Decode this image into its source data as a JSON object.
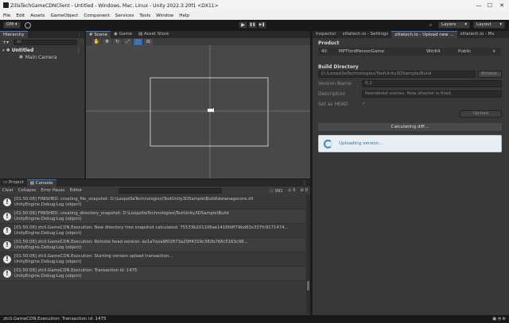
{
  "window": {
    "title": "ZillaTechGameCDNClient - Untitled - Windows, Mac, Linux - Unity 2022.3.20f1 <DX11>",
    "controls": [
      "—",
      "☐",
      "✕"
    ]
  },
  "menu": [
    "File",
    "Edit",
    "Assets",
    "GameObject",
    "Component",
    "Services",
    "Tools",
    "Window",
    "Help"
  ],
  "toolbar": {
    "account": "OM",
    "layers": "Layers",
    "layout": "Layout",
    "play": "▶",
    "pause": "❚❚",
    "step": "▶❚"
  },
  "hierarchy": {
    "tab": "Hierarchy",
    "scene": "Untitled",
    "items": [
      "Main Camera"
    ],
    "search_hint": "All"
  },
  "scene_tabs": [
    "Scene",
    "Game",
    "Asset Store"
  ],
  "console": {
    "tabs": [
      "Project",
      "Console"
    ],
    "toolbar": {
      "clear": "Clear",
      "collapse": "Collapse",
      "error_pause": "Error Pause",
      "editor": "Editor"
    },
    "counts": {
      "info": "991",
      "warn": "0",
      "error": "0"
    },
    "logs": [
      {
        "line1": "[01:50:08] FINISHED: creating_file_snapshot: D:\\LoopzillaTechnologies\\TestUnity3DSample\\Build\\datanagecore.dll",
        "line2": "UnityEngine.Debug:Log (object)"
      },
      {
        "line1": "[01:50:08] FINISHED: creating_directory_snapshot: D:\\LoopzillaTechnologies\\TestUnity3DSample\\Build",
        "line2": "UnityEngine.Debug:Log (object)"
      },
      {
        "line1": "[01:50:08] ztcli.GameCDN.Execution: New directory tree snapshot calculated: 75533b201106ae1416fdff79bd82e337fc9171474...",
        "line2": "UnityEngine.Debug:Log (object)"
      },
      {
        "line1": "[01:50:08] ztcli.GameCDN.Execution: Remote head version: ae1a7eea9f02873a20ff4319c382b768c5163c98...",
        "line2": "UnityEngine.Debug:Log (object)"
      },
      {
        "line1": "[01:50:08] ztcli.GameCDN.Execution: Starting version upload transaction...",
        "line2": "UnityEngine.Debug:Log (object)"
      },
      {
        "line1": "[01:50:08] ztcli.GameCDN.Execution: Transaction id: 1475",
        "line2": "UnityEngine.Debug:Log (object)"
      }
    ]
  },
  "inspector": {
    "tabs": [
      "Inspector",
      "zillatech.io - Settings",
      "zillatech.io - Upload new ...",
      "zillatech.io - Mx"
    ],
    "product_header": "Product",
    "product": {
      "id": "40",
      "name": "MPThirdPersonGame",
      "platform": "Win64",
      "visibility": "Public"
    },
    "build_header": "Build Directory",
    "build_path": "D:/LoopzillaTechnologies/TestUnity3DSample/Build",
    "browse": "Browse...",
    "version_label": "Version Name",
    "version_value": "0.2",
    "description_label": "Description",
    "description_value": "Reordered scenes. Now shooter is fired.",
    "head_label": "Set as HEAD",
    "head_check": "✓",
    "upload": "Upload",
    "calculating": "Calculating diff...",
    "status": "Uploading version..."
  },
  "statusbar": {
    "text": "ztcli.GameCDN.Execution: Transaction id: 1475"
  }
}
